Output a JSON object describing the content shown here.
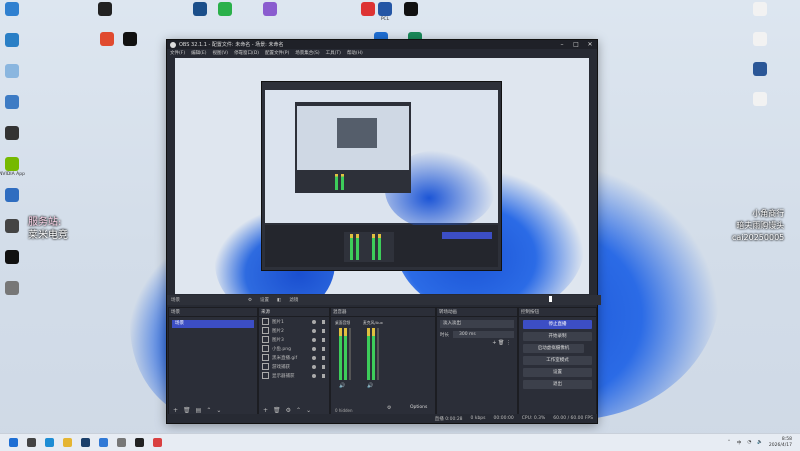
{
  "desktop": {
    "left_icons": [
      {
        "name": "folder-icon",
        "label": "",
        "color": "#2f80d0"
      },
      {
        "name": "pc-icon",
        "label": "",
        "color": "#2a7fc6"
      },
      {
        "name": "recycle-bin-icon",
        "label": "",
        "color": "#8ab6df"
      },
      {
        "name": "control-panel-icon",
        "label": "",
        "color": "#3d7bc4"
      },
      {
        "name": "obs-desktop-icon",
        "label": "",
        "color": "#333"
      },
      {
        "name": "nvidia-icon",
        "label": "NVIDIA App",
        "color": "#76b900"
      },
      {
        "name": "settings-app-icon",
        "label": "",
        "color": "#2f6dc0"
      },
      {
        "name": "video-icon",
        "label": "",
        "color": "#444"
      },
      {
        "name": "ghub-icon",
        "label": "",
        "color": "#111"
      },
      {
        "name": "app-icon",
        "label": "",
        "color": "#777"
      }
    ],
    "top_icons": [
      {
        "name": "app-icon",
        "label": "",
        "color": "#222"
      },
      {
        "name": "app-red-icon",
        "label": "",
        "color": "#e04a2f"
      },
      {
        "name": "qq-icon",
        "label": "",
        "color": "#111"
      },
      {
        "name": "steam-icon",
        "label": "",
        "color": "#1b4f8a"
      },
      {
        "name": "wechat-icon",
        "label": "",
        "color": "#2ab04a"
      },
      {
        "name": "network-icon",
        "label": "",
        "color": "#8a5ccf"
      },
      {
        "name": "app-red-icon",
        "label": "",
        "color": "#d33"
      },
      {
        "name": "game-icon",
        "label": "",
        "color": "#1f6fd4"
      },
      {
        "name": "pcl-icon",
        "label": "PCL",
        "color": "#2456a5"
      },
      {
        "name": "launcher-icon",
        "label": "",
        "color": "#111"
      },
      {
        "name": "green-app-icon",
        "label": "",
        "color": "#1a8a5a"
      }
    ],
    "right_icons": [
      {
        "name": "document-icon",
        "label": "",
        "color": "#f2f2f2"
      },
      {
        "name": "document-icon",
        "label": "",
        "color": "#f2f2f2"
      },
      {
        "name": "word-icon",
        "label": "",
        "color": "#2b5797"
      },
      {
        "name": "document-icon",
        "label": "",
        "color": "#f2f2f2"
      }
    ],
    "overlay_left": {
      "line1": "服务站:",
      "line2": "莱米电竞"
    },
    "overlay_right": {
      "line1": "小角商行",
      "line2": "暗夫雨购馒头",
      "line3": "cai20250005"
    }
  },
  "obs": {
    "title": "OBS 32.1.1 - 配置文件: 未命名 - 场景: 未命名",
    "menu": [
      "文件(F)",
      "编辑(E)",
      "视图(V)",
      "停靠窗口(D)",
      "配置文件(P)",
      "场景集合(S)",
      "工具(T)",
      "帮助(H)"
    ],
    "toolbar": {
      "scene_label": "场景",
      "source_tab1": "设置",
      "source_tab2": "滤镜"
    },
    "docks": {
      "scenes": {
        "title": "场景",
        "items": [
          "场景"
        ]
      },
      "sources": {
        "title": "来源",
        "items": [
          "图片1",
          "图片2",
          "图片3",
          "小鱼.png",
          "黑米直播.gif",
          "游戏捕获",
          "显示器捕获"
        ]
      },
      "mixer": {
        "title": "混音器",
        "ch1": "桌面音频",
        "ch2": "麦克风/Aux",
        "count": "0 hidden"
      },
      "transitions": {
        "title": "转场动画",
        "type": "淡入淡出",
        "duration_label": "时长",
        "duration": "300 ms"
      },
      "controls": {
        "title": "控制按钮",
        "buttons": [
          "停止直播",
          "开始录制",
          "启动虚拟摄像机",
          "工作室模式",
          "设置",
          "退出"
        ]
      }
    },
    "statusbar": {
      "time": "直播 0:00:28",
      "bitrate": "0 kbps",
      "rec": "00:00:00",
      "cpu": "CPU: 0.3%",
      "fps": "60.00 / 60.00 FPS"
    },
    "options_label": "Options"
  },
  "taskbar": {
    "icons": [
      {
        "name": "start-icon",
        "color": "#1f6fd4"
      },
      {
        "name": "search-icon",
        "color": "#444"
      },
      {
        "name": "edge-icon",
        "color": "#1e8dd4"
      },
      {
        "name": "explorer-icon",
        "color": "#e5b532"
      },
      {
        "name": "steam-icon",
        "color": "#1b3f6a"
      },
      {
        "name": "app-icon",
        "color": "#3079d6"
      },
      {
        "name": "settings-icon",
        "color": "#777"
      },
      {
        "name": "obs-icon",
        "color": "#222"
      },
      {
        "name": "red-app-icon",
        "color": "#d94040"
      }
    ],
    "tray": {
      "lang": "中",
      "time": "8:58",
      "date": "2026/4/17"
    }
  }
}
